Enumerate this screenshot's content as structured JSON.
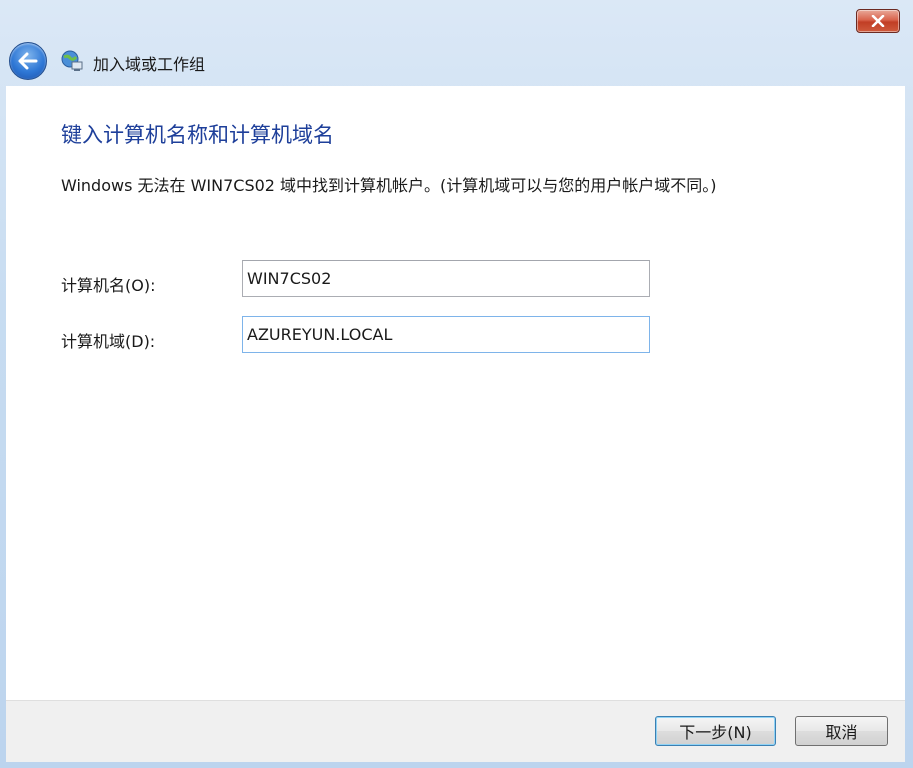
{
  "window": {
    "title": "加入域或工作组"
  },
  "icons": {
    "close": "close-icon",
    "back": "back-arrow-icon",
    "wizard": "network-computer-icon"
  },
  "page": {
    "heading": "键入计算机名称和计算机域名",
    "description": "Windows 无法在 WIN7CS02 域中找到计算机帐户。(计算机域可以与您的用户帐户域不同。)"
  },
  "form": {
    "computer_name_label": "计算机名(O):",
    "computer_name_value": "WIN7CS02",
    "computer_domain_label": "计算机域(D):",
    "computer_domain_value": "AZUREYUN.LOCAL"
  },
  "buttons": {
    "next": "下一步(N)",
    "cancel": "取消"
  },
  "colors": {
    "heading": "#1e3f9a",
    "close_button": "#c13e25",
    "back_button": "#2f78d6"
  }
}
